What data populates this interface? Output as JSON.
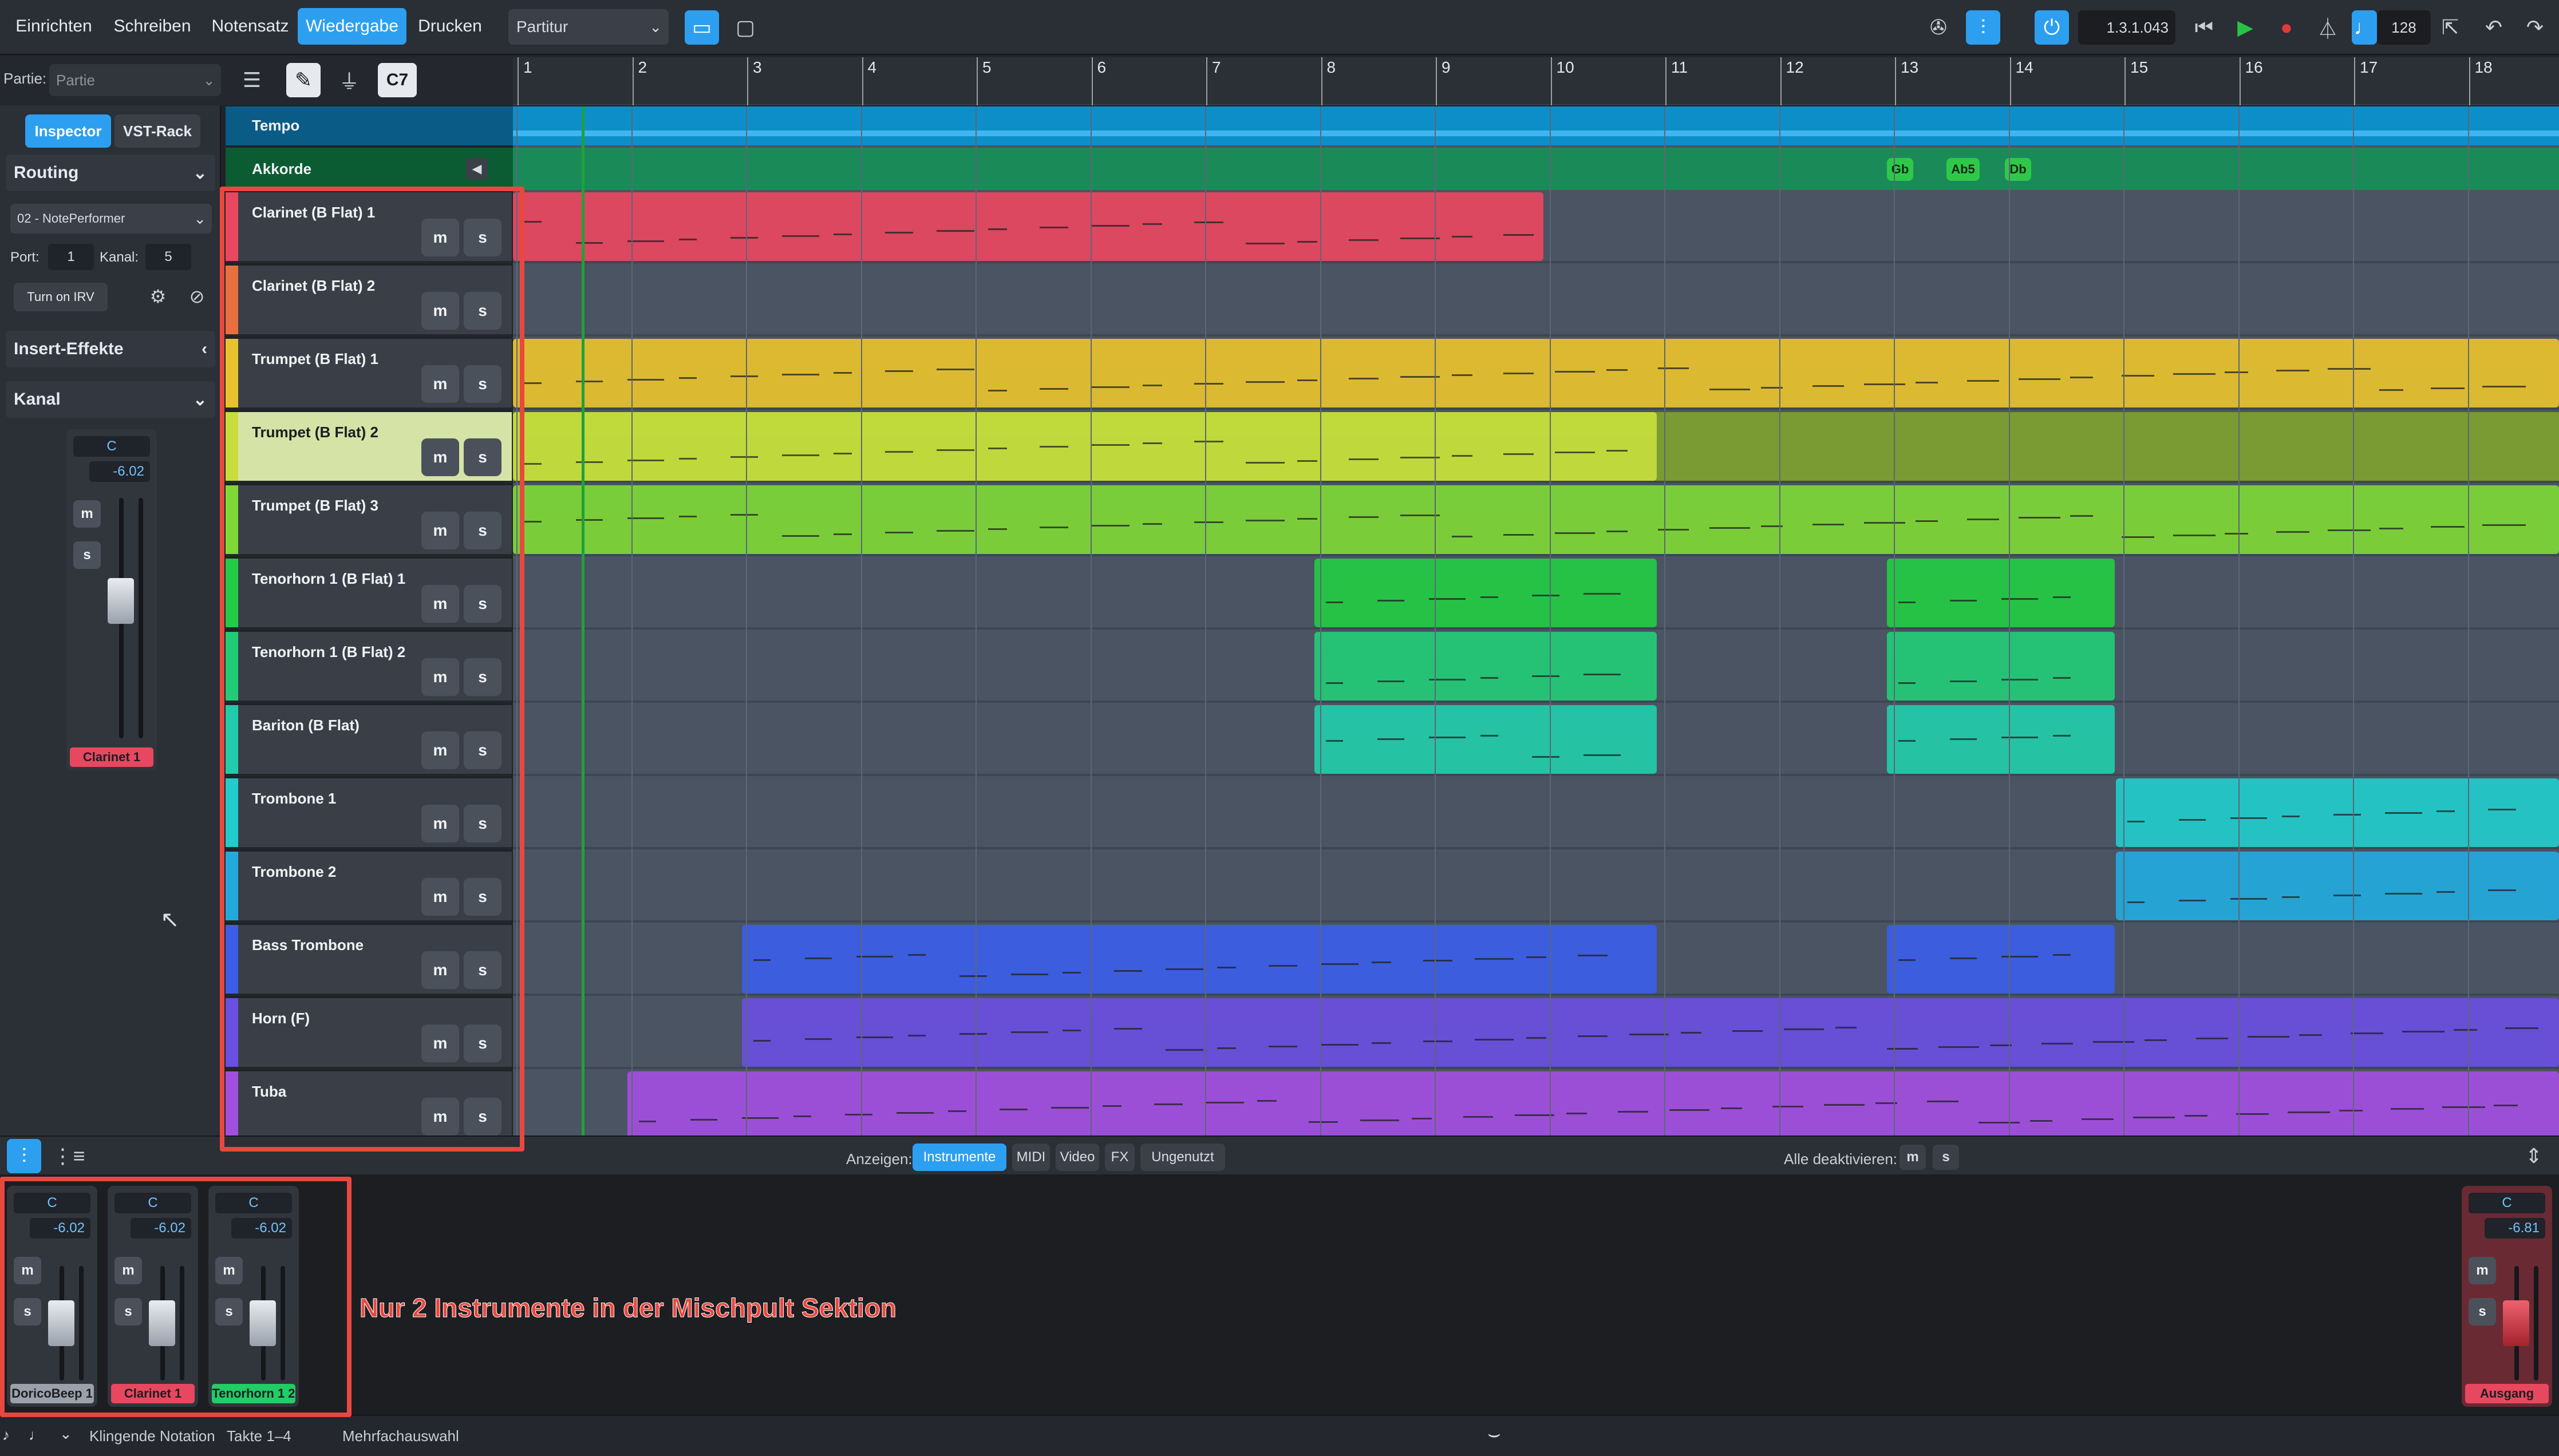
{
  "topbar": {
    "modes": [
      "Einrichten",
      "Schreiben",
      "Notensatz",
      "Wiedergabe",
      "Drucken"
    ],
    "active_mode": "Wiedergabe",
    "layout_select": "Partitur",
    "position": "1.3.1.043",
    "tempo": "128"
  },
  "toolbar2": {
    "partie_label": "Partie:",
    "partie_value": "Partie",
    "chord_btn": "C7"
  },
  "ruler": {
    "bars": [
      "1",
      "2",
      "3",
      "4",
      "5",
      "6",
      "7",
      "8",
      "9",
      "10",
      "11",
      "12",
      "13",
      "14",
      "15",
      "16",
      "17",
      "18"
    ]
  },
  "inspector": {
    "tabs": [
      "Inspector",
      "VST-Rack"
    ],
    "active_tab": "Inspector",
    "routing_label": "Routing",
    "device": "02 - NotePerformer",
    "port_label": "Port:",
    "port_value": "1",
    "kanal_label": "Kanal:",
    "kanal_value": "5",
    "irv_button": "Turn on IRV",
    "insert_label": "Insert-Effekte",
    "kanal_section": "Kanal",
    "channel": {
      "pan": "C",
      "volume": "-6.02",
      "name": "Clarinet 1"
    }
  },
  "special_tracks": [
    {
      "name": "Tempo",
      "color": "#0d8ec9"
    },
    {
      "name": "Akkorde",
      "color": "#128a4a",
      "chords": [
        "Gb",
        "Ab5",
        "Db"
      ]
    }
  ],
  "tracks": [
    {
      "name": "Clarinet (B Flat) 1",
      "color": "#e8485f"
    },
    {
      "name": "Clarinet (B Flat) 2",
      "color": "#e8703f"
    },
    {
      "name": "Trumpet (B Flat) 1",
      "color": "#e8c22d"
    },
    {
      "name": "Trumpet (B Flat) 2",
      "color": "#c5de3c"
    },
    {
      "name": "Trumpet (B Flat) 3",
      "color": "#7ed836"
    },
    {
      "name": "Tenorhorn 1 (B Flat) 1",
      "color": "#22cc44"
    },
    {
      "name": "Tenorhorn 1 (B Flat) 2",
      "color": "#22cc77"
    },
    {
      "name": "Bariton (B Flat)",
      "color": "#22ccaa"
    },
    {
      "name": "Trombone 1",
      "color": "#22cccc"
    },
    {
      "name": "Trombone 2",
      "color": "#22aadd"
    },
    {
      "name": "Bass Trombone",
      "color": "#3b5ee8"
    },
    {
      "name": "Horn (F)",
      "color": "#6a4fe0"
    },
    {
      "name": "Tuba",
      "color": "#a24fe0"
    }
  ],
  "mute_label": "m",
  "solo_label": "s",
  "mixerbar": {
    "show_label": "Anzeigen:",
    "filters": [
      "Instrumente",
      "MIDI",
      "Video",
      "FX",
      "Ungenutzt"
    ],
    "active_filter": "Instrumente",
    "deactivate_label": "Alle deaktivieren:"
  },
  "mixer": {
    "strips": [
      {
        "pan": "C",
        "volume": "-6.02",
        "name": "DoricoBeep 1",
        "color": "#9aa1ab"
      },
      {
        "pan": "C",
        "volume": "-6.02",
        "name": "Clarinet 1",
        "color": "#e8485f"
      },
      {
        "pan": "C",
        "volume": "-6.02",
        "name": "Tenorhorn 1 2",
        "color": "#22cc66"
      }
    ],
    "output": {
      "pan": "C",
      "volume": "-6.81",
      "name": "Ausgang",
      "color": "#e8485f"
    },
    "annotation": "Nur 2 Instrumente in der Mischpult Sektion"
  },
  "statusbar": {
    "items": [
      "Klingende Notation",
      "Takte 1–4",
      "Mehrfachauswahl"
    ]
  }
}
